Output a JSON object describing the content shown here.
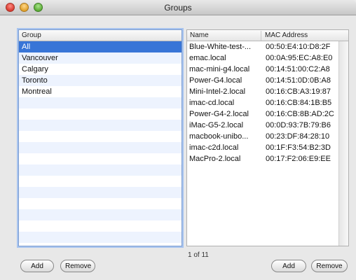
{
  "window": {
    "title": "Groups"
  },
  "groups": {
    "header": "Group",
    "items": [
      "All",
      "Vancouver",
      "Calgary",
      "Toronto",
      "Montreal"
    ],
    "selected_index": 0,
    "add_label": "Add",
    "remove_label": "Remove"
  },
  "machines": {
    "headers": {
      "name": "Name",
      "mac": "MAC Address"
    },
    "rows": [
      {
        "name": "Blue-White-test-...",
        "mac": "00:50:E4:10:D8:2F"
      },
      {
        "name": "emac.local",
        "mac": "00:0A:95:EC:A8:E0"
      },
      {
        "name": "mac-mini-g4.local",
        "mac": "00:14:51:00:C2:A8"
      },
      {
        "name": "Power-G4.local",
        "mac": "00:14:51:0D:0B:A8"
      },
      {
        "name": "Mini-Intel-2.local",
        "mac": "00:16:CB:A3:19:87"
      },
      {
        "name": "imac-cd.local",
        "mac": "00:16:CB:84:1B:B5"
      },
      {
        "name": "Power-G4-2.local",
        "mac": "00:16:CB:8B:AD:2C"
      },
      {
        "name": "iMac-G5-2.local",
        "mac": "00:0D:93:7B:79:B6"
      },
      {
        "name": "macbook-unibo...",
        "mac": "00:23:DF:84:28:10"
      },
      {
        "name": "imac-c2d.local",
        "mac": "00:1F:F3:54:B2:3D"
      },
      {
        "name": "MacPro-2.local",
        "mac": "00:17:F2:06:E9:EE"
      }
    ],
    "status": "1 of 11",
    "add_label": "Add",
    "remove_label": "Remove"
  }
}
